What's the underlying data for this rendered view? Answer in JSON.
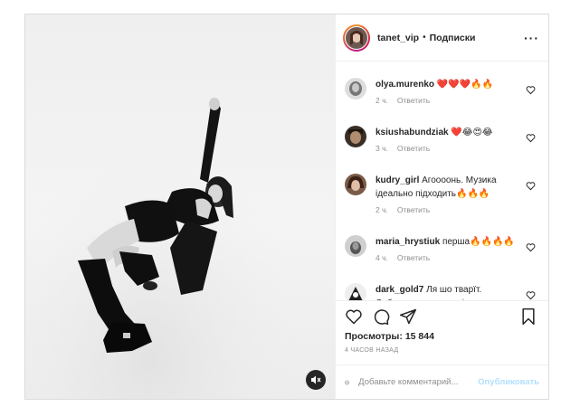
{
  "header": {
    "username": "tanet_vip",
    "separator": "•",
    "follow_label": "Подписки",
    "more_icon": "more-dots-icon"
  },
  "comments": [
    {
      "user": "olya.murenko",
      "text": "❤️❤️❤️🔥🔥",
      "time": "2 ч.",
      "reply": "Ответить"
    },
    {
      "user": "ksiushabundziak",
      "text": "❤️😂😍😂",
      "time": "3 ч.",
      "reply": "Ответить"
    },
    {
      "user": "kudry_girl",
      "text": "Агоооонь. Музика ідеально підходить🔥🔥🔥",
      "time": "2 ч.",
      "reply": "Ответить"
    },
    {
      "user": "maria_hrystiuk",
      "text": "перша🔥🔥🔥🔥",
      "time": "4 ч.",
      "reply": "Ответить"
    },
    {
      "user": "dark_gold7",
      "text": "Ля шо тварїт. Соблазняє пацанчиків",
      "time": "",
      "reply": ""
    }
  ],
  "actions": {
    "views_label": "Просмотры:",
    "views_count": "15 844",
    "time_ago": "4 часов назад"
  },
  "add_comment": {
    "placeholder": "Добавьте комментарий...",
    "publish_label": "Опубликовать"
  },
  "colors": {
    "border": "#dbdbdb",
    "muted": "#8e8e8e",
    "publish_disabled": "#b2dffc",
    "heart_red": "#ed4956"
  }
}
